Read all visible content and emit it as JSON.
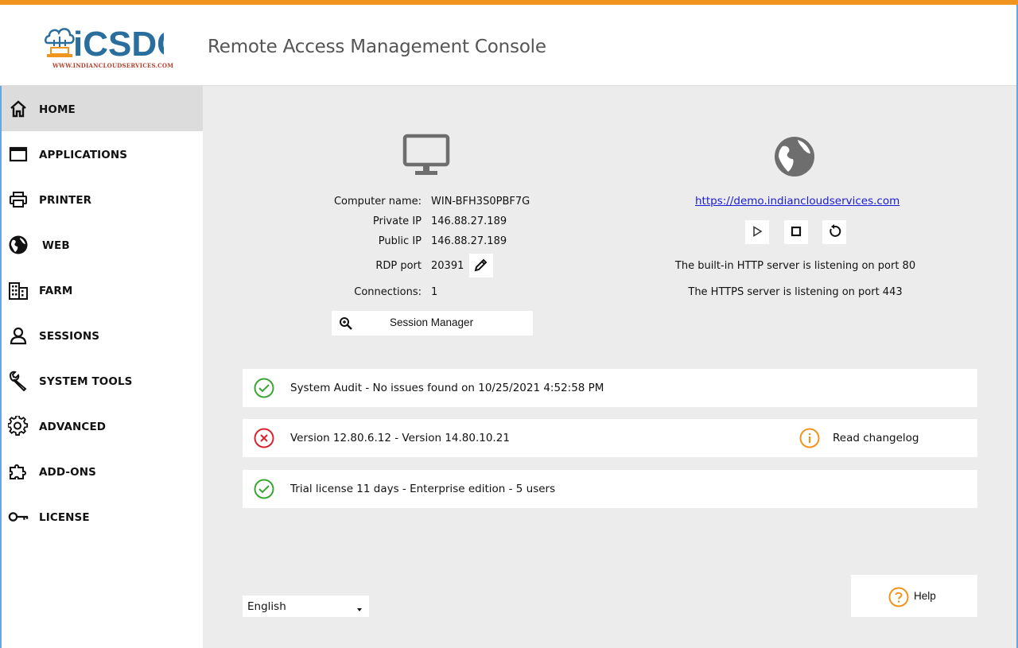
{
  "header": {
    "logo_text": "iCSDC",
    "logo_subtext": "WWW.INDIANCLOUDSERVICES.COM",
    "title": "Remote Access Management Console"
  },
  "sidebar": {
    "items": [
      {
        "label": "HOME",
        "icon": "home-icon",
        "active": true
      },
      {
        "label": "APPLICATIONS",
        "icon": "window-icon"
      },
      {
        "label": "PRINTER",
        "icon": "printer-icon"
      },
      {
        "label": "WEB",
        "icon": "globe-icon"
      },
      {
        "label": "FARM",
        "icon": "building-icon"
      },
      {
        "label": "SESSIONS",
        "icon": "user-icon"
      },
      {
        "label": "SYSTEM TOOLS",
        "icon": "wrench-icon"
      },
      {
        "label": "ADVANCED",
        "icon": "gear-icon"
      },
      {
        "label": "ADD-ONS",
        "icon": "puzzle-icon"
      },
      {
        "label": "LICENSE",
        "icon": "key-icon"
      }
    ]
  },
  "server": {
    "computer_name_label": "Computer name:",
    "computer_name": "WIN-BFH3S0PBF7G",
    "private_ip_label": "Private IP",
    "private_ip": "146.88.27.189",
    "public_ip_label": "Public IP",
    "public_ip": "146.88.27.189",
    "rdp_port_label": "RDP port",
    "rdp_port": "20391",
    "connections_label": "Connections:",
    "connections": "1",
    "session_manager_label": "Session Manager"
  },
  "web": {
    "url": "https://demo.indiancloudservices.com",
    "http_status": "The built-in HTTP server is listening on port 80",
    "https_status": "The HTTPS server is listening on port 443"
  },
  "status": {
    "audit": "System Audit - No issues found on 10/25/2021 4:52:58 PM",
    "version": "Version 12.80.6.12 - Version 14.80.10.21",
    "changelog_label": "Read changelog",
    "license": "Trial license 11 days - Enterprise edition - 5 users"
  },
  "footer": {
    "language": "English",
    "help_label": "Help"
  },
  "colors": {
    "accent": "#f0941d",
    "ok": "#3aa635",
    "error": "#d9232e",
    "warning": "#f0941d",
    "link": "#1a1ad6"
  }
}
